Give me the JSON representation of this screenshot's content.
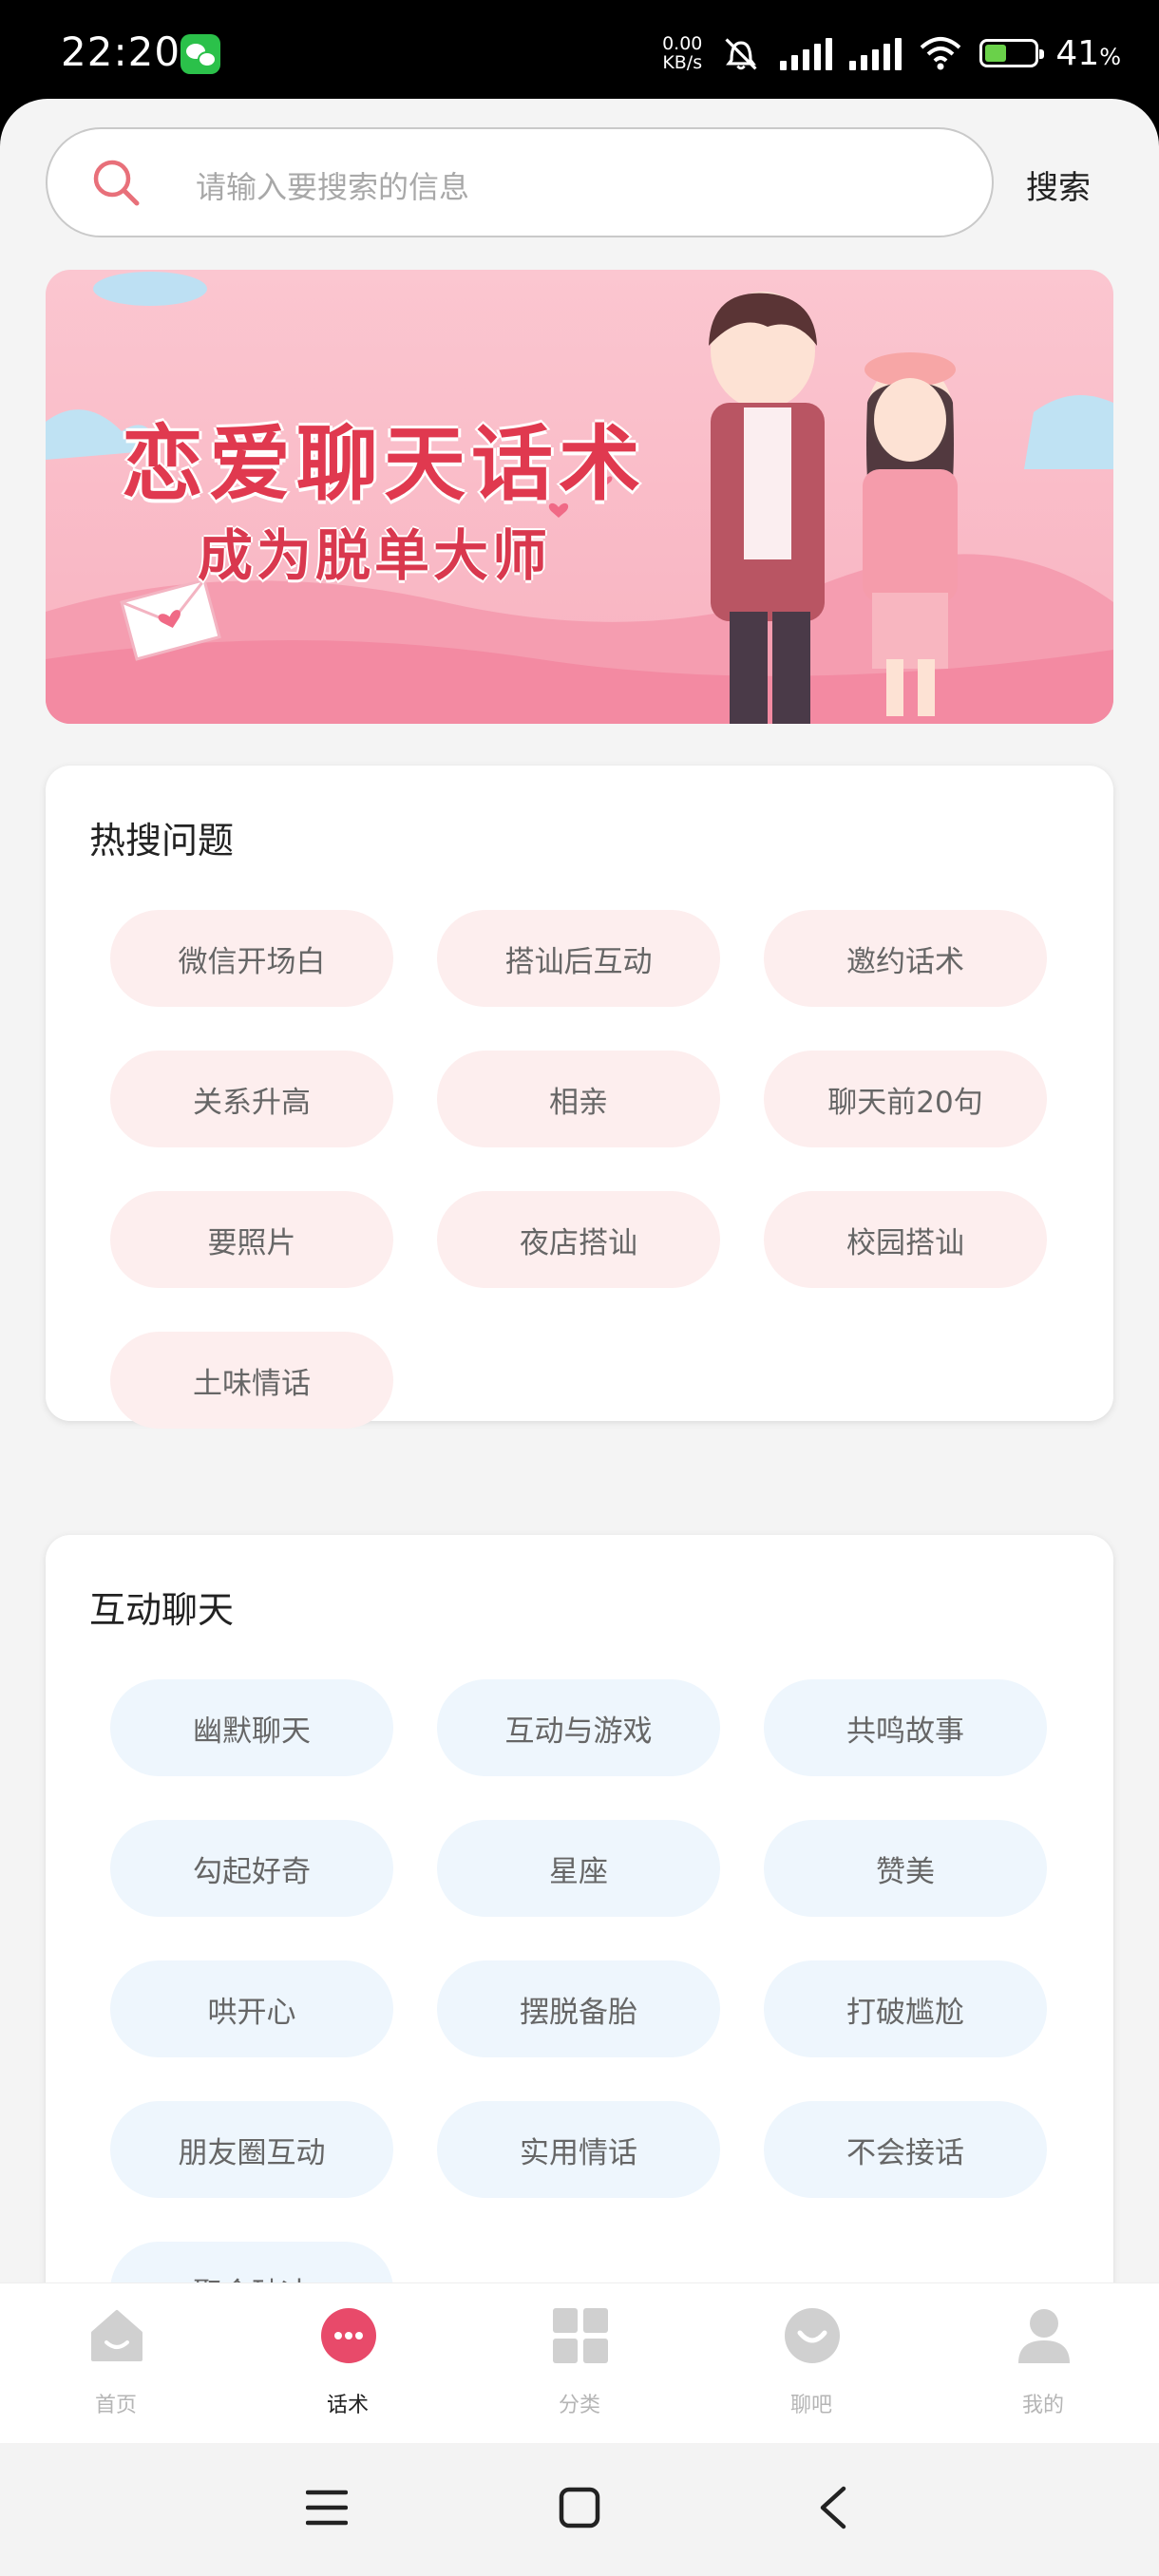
{
  "status_bar": {
    "time": "22:20",
    "net_speed_value": "0.00",
    "net_speed_unit": "KB/s",
    "battery_percent": "41",
    "battery_percent_sign": "%",
    "icons": [
      "wechat-icon",
      "silent-alarm-icon",
      "signal-icon",
      "hd-signal-icon",
      "wifi-icon",
      "battery-charging-icon"
    ]
  },
  "search": {
    "placeholder": "请输入要搜索的信息",
    "button_label": "搜索"
  },
  "banner": {
    "title": "恋爱聊天话术",
    "subtitle": "成为脱单大师"
  },
  "hot_section": {
    "title": "热搜问题",
    "tags": [
      "微信开场白",
      "搭讪后互动",
      "邀约话术",
      "关系升高",
      "相亲",
      "聊天前20句",
      "要照片",
      "夜店搭讪",
      "校园搭讪",
      "土味情话"
    ]
  },
  "chat_section": {
    "title": "互动聊天",
    "tags": [
      "幽默聊天",
      "互动与游戏",
      "共鸣故事",
      "勾起好奇",
      "星座",
      "赞美",
      "哄开心",
      "摆脱备胎",
      "打破尴尬",
      "朋友圈互动",
      "实用情话",
      "不会接话",
      "聚会破冰"
    ]
  },
  "tab_bar": {
    "items": [
      {
        "label": "首页",
        "icon": "home-icon",
        "active": false
      },
      {
        "label": "话术",
        "icon": "chat-bubble-icon",
        "active": true
      },
      {
        "label": "分类",
        "icon": "grid-icon",
        "active": false
      },
      {
        "label": "聊吧",
        "icon": "smile-bubble-icon",
        "active": false
      },
      {
        "label": "我的",
        "icon": "profile-icon",
        "active": false
      }
    ]
  },
  "colors": {
    "accent": "#e84a6a",
    "pink_tag": "#fdeeee",
    "blue_tag": "#eef6fd",
    "inactive_icon": "#d0d0d0"
  }
}
